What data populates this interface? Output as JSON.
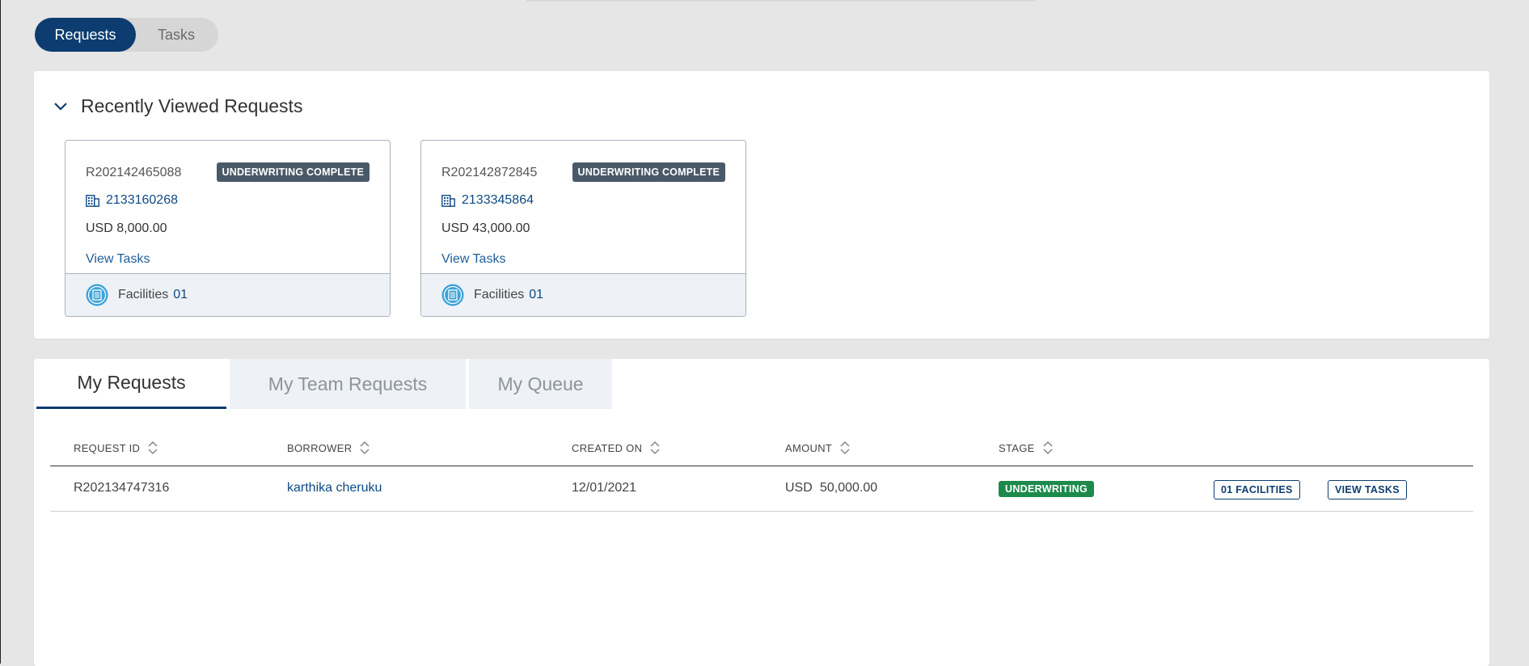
{
  "toggle": {
    "requests_label": "Requests",
    "tasks_label": "Tasks"
  },
  "recent": {
    "title": "Recently Viewed Requests",
    "cards": [
      {
        "request_id": "R202142465088",
        "status": "UNDERWRITING COMPLETE",
        "borrower_id": "2133160268",
        "amount": "USD 8,000.00",
        "view_tasks": "View Tasks",
        "facilities_label": "Facilities",
        "facilities_count": "01"
      },
      {
        "request_id": "R202142872845",
        "status": "UNDERWRITING COMPLETE",
        "borrower_id": "2133345864",
        "amount": "USD 43,000.00",
        "view_tasks": "View Tasks",
        "facilities_label": "Facilities",
        "facilities_count": "01"
      }
    ]
  },
  "tabs": [
    {
      "label": "My Requests"
    },
    {
      "label": "My Team Requests"
    },
    {
      "label": "My Queue"
    }
  ],
  "table": {
    "headers": [
      "REQUEST ID",
      "BORROWER",
      "CREATED ON",
      "AMOUNT",
      "STAGE"
    ],
    "rows": [
      {
        "request_id": "R202134747316",
        "borrower": "karthika cheruku",
        "created_on": "12/01/2021",
        "currency": "USD",
        "amount": "50,000.00",
        "stage": "UNDERWRITING",
        "facilities_btn": "01 FACILITIES",
        "view_tasks_btn": "VIEW TASKS"
      }
    ]
  },
  "colors": {
    "primary": "#0d3d70",
    "stage_green": "#1d8a4c",
    "badge_gray": "#4a5968"
  }
}
